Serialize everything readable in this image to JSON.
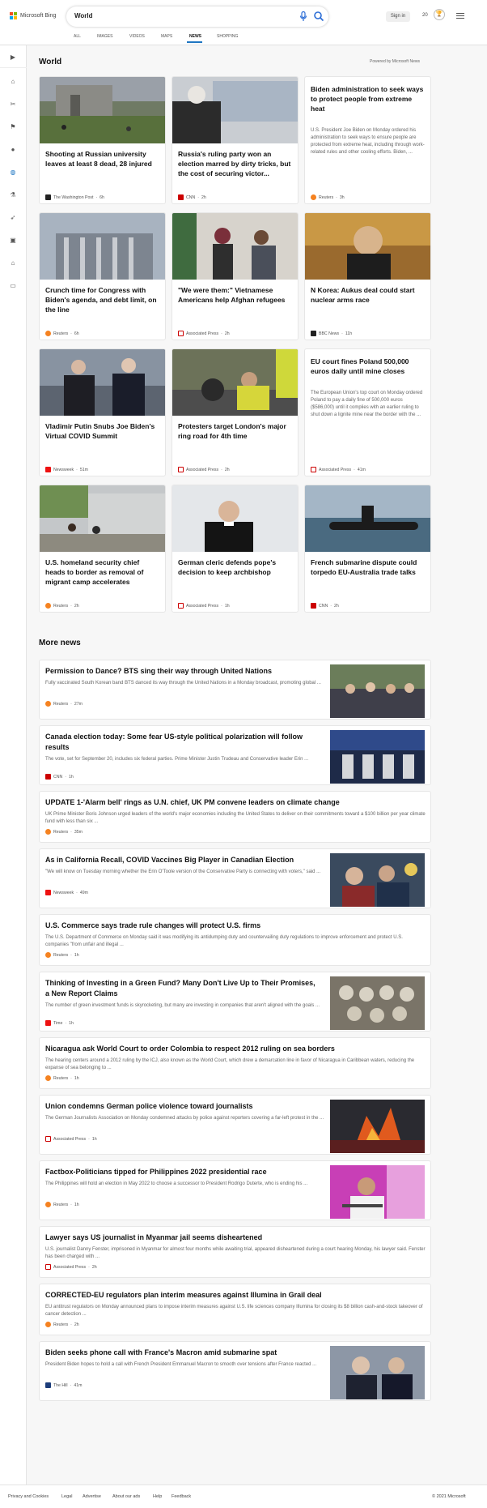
{
  "brand": {
    "name": "Microsoft Bing"
  },
  "search": {
    "value": "World"
  },
  "account": {
    "sign_in": "Sign in",
    "points": "20"
  },
  "tabs": [
    "ALL",
    "IMAGES",
    "VIDEOS",
    "MAPS",
    "NEWS",
    "SHOPPING"
  ],
  "active_tab": "NEWS",
  "section": {
    "title": "World",
    "powered": "Powered by Microsoft News"
  },
  "cards": [
    {
      "title": "Shooting at Russian university leaves at least 8 dead, 28 injured",
      "source": "The Washington Post",
      "time": "6h"
    },
    {
      "title": "Russia's ruling party won an election marred by dirty tricks, but the cost of securing victor...",
      "source": "CNN",
      "time": "2h"
    },
    {
      "title": "Biden administration to seek ways to protect people from extreme heat",
      "desc": "U.S. President Joe Biden on Monday ordered his administration to seek ways to ensure people are protected from extreme heat, including through work-related rules and other cooling efforts. Biden, ...",
      "source": "Reuters",
      "time": "3h"
    },
    {
      "title": "Crunch time for Congress with Biden's agenda, and debt limit, on the line",
      "source": "Reuters",
      "time": "6h"
    },
    {
      "title": "\"We were them:\" Vietnamese Americans help Afghan refugees",
      "source": "Associated Press",
      "time": "2h"
    },
    {
      "title": "N Korea: Aukus deal could start nuclear arms race",
      "source": "BBC News",
      "time": "11h"
    },
    {
      "title": "Vladimir Putin Snubs Joe Biden's Virtual COVID Summit",
      "source": "Newsweek",
      "time": "51m"
    },
    {
      "title": "Protesters target London's major ring road for 4th time",
      "source": "Associated Press",
      "time": "2h"
    },
    {
      "title": "EU court fines Poland 500,000 euros daily until mine closes",
      "desc": "The European Union's top court on Monday ordered Poland to pay a daily fine of 500,000 euros ($586,000) until it complies with an earlier ruling to shut down a lignite mine near the border with the ...",
      "source": "Associated Press",
      "time": "41m"
    },
    {
      "title": "U.S. homeland security chief heads to border as removal of migrant camp accelerates",
      "source": "Reuters",
      "time": "2h"
    },
    {
      "title": "German cleric defends pope's decision to keep archbishop",
      "source": "Associated Press",
      "time": "1h"
    },
    {
      "title": "French submarine dispute could torpedo EU-Australia trade talks",
      "source": "CNN",
      "time": "2h"
    }
  ],
  "more_title": "More news",
  "more": [
    {
      "title": "Permission to Dance? BTS sing their way through United Nations",
      "desc": "Fully vaccinated South Korean band BTS danced its way through the United Nations in a Monday broadcast, promoting global ...",
      "source": "Reuters",
      "time": "27m"
    },
    {
      "title": "Canada election today: Some fear US-style political polarization will follow results",
      "desc": "The vote, set for September 20, includes six federal parties. Prime Minister Justin Trudeau and Conservative leader Erin ...",
      "source": "CNN",
      "time": "1h"
    },
    {
      "title": "UPDATE 1-'Alarm bell' rings as U.N. chief, UK PM convene leaders on climate change",
      "desc": "UK Prime Minister Boris Johnson urged leaders of the world's major economies including the United States to deliver on their commitments toward a $100 billion per year climate fund with less than six ...",
      "source": "Reuters",
      "time": "35m"
    },
    {
      "title": "As in California Recall, COVID Vaccines Big Player in Canadian Election",
      "desc": "\"We will know on Tuesday morning whether the Erin O'Toole version of the Conservative Party is connecting with voters,\" said ...",
      "source": "Newsweek",
      "time": "49m"
    },
    {
      "title": "U.S. Commerce says trade rule changes will protect U.S. firms",
      "desc": "The U.S. Department of Commerce on Monday said it was modifying its antidumping duty and countervailing duty regulations to improve enforcement and protect U.S. companies \"from unfair and illegal ...",
      "source": "Reuters",
      "time": "1h"
    },
    {
      "title": "Thinking of Investing in a Green Fund? Many Don't Live Up to Their Promises, a New Report Claims",
      "desc": "The number of green investment funds is skyrocketing, but many are investing in companies that aren't aligned with the goals ...",
      "source": "Time",
      "time": "1h"
    },
    {
      "title": "Nicaragua ask World Court to order Colombia to respect 2012 ruling on sea borders",
      "desc": "The hearing centers around a 2012 ruling by the ICJ, also known as the World Court, which drew a demarcation line in favor of Nicaragua in Caribbean waters, reducing the expanse of sea belonging to ...",
      "source": "Reuters",
      "time": "1h"
    },
    {
      "title": "Union condemns German police violence toward journalists",
      "desc": "The German Journalists Association on Monday condemned attacks by police against reporters covering a far-left protest in the ...",
      "source": "Associated Press",
      "time": "1h"
    },
    {
      "title": "Factbox-Politicians tipped for Philippines 2022 presidential race",
      "desc": "The Philippines will hold an election in May 2022 to choose a successor to President Rodrigo Duterte, who is ending his ...",
      "source": "Reuters",
      "time": "1h"
    },
    {
      "title": "Lawyer says US journalist in Myanmar jail seems disheartened",
      "desc": "U.S. journalist Danny Fenster, imprisoned in Myanmar for almost four months while awaiting trial, appeared disheartened during a court hearing Monday, his lawyer said. Fenster has been charged with ...",
      "source": "Associated Press",
      "time": "2h"
    },
    {
      "title": "CORRECTED-EU regulators plan interim measures against Illumina in Grail deal",
      "desc": "EU antitrust regulators on Monday announced plans to impose interim measures against U.S. life sciences company Illumina for closing its $8 billion cash-and-stock takeover of cancer detection ...",
      "source": "Reuters",
      "time": "2h"
    },
    {
      "title": "Biden seeks phone call with France's Macron amid submarine spat",
      "desc": "President Biden hopes to hold a call with French President Emmanuel Macron to smooth over tensions after France reacted ...",
      "source": "The Hill",
      "time": "41m"
    }
  ],
  "footer": {
    "links": [
      "Privacy and Cookies",
      "Legal",
      "Advertise",
      "About our ads",
      "Help",
      "Feedback"
    ],
    "copyright": "© 2021 Microsoft"
  }
}
